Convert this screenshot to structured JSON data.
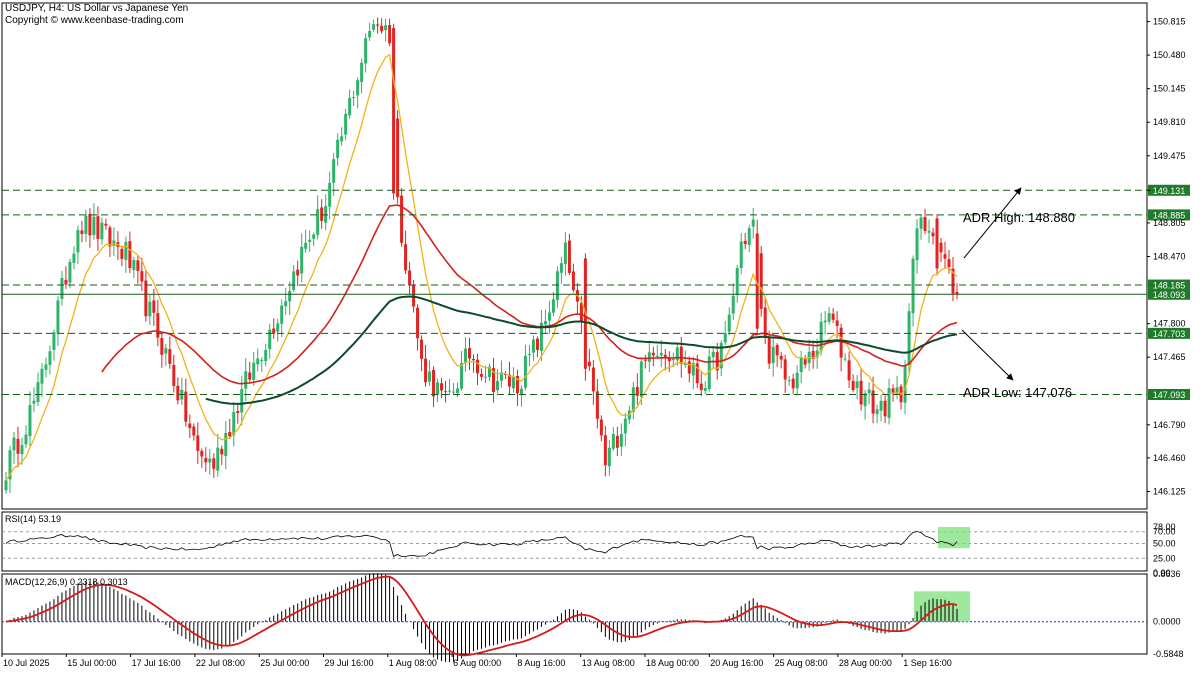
{
  "header": {
    "title": "USDJPY, H4:  US Dollar vs Japanese Yen",
    "copyright": "Copyright © www.keenbase-trading.com"
  },
  "colors": {
    "bull": "#2fb36b",
    "bear": "#e32222",
    "ma_fast": "#f2b21c",
    "ma_mid": "#d42020",
    "ma_slow": "#0c4a2a",
    "level_tag": "#1f7a2a",
    "level_line": "#1a5a1a",
    "highlight": "#7ee07e",
    "macd_signal": "#d61a1a",
    "zero_line": "#3030b0"
  },
  "chart_data": [
    {
      "type": "candlestick",
      "symbol": "USDJPY",
      "timeframe": "H4",
      "ylim": [
        145.95,
        151.0
      ],
      "y_ticks": [
        "150.815",
        "150.480",
        "150.145",
        "149.810",
        "149.475",
        "149.131",
        "148.805",
        "148.470",
        "147.800",
        "147.465",
        "146.790",
        "146.460",
        "146.125"
      ],
      "x_labels": [
        "10 Jul 2025",
        "15 Jul 00:00",
        "17 Jul 16:00",
        "22 Jul 08:00",
        "25 Jul 00:00",
        "29 Jul 16:00",
        "1 Aug 08:00",
        "6 Aug 00:00",
        "8 Aug 16:00",
        "13 Aug 08:00",
        "18 Aug 00:00",
        "20 Aug 16:00",
        "25 Aug 08:00",
        "28 Aug 00:00",
        "1 Sep 16:00"
      ],
      "levels": [
        {
          "value": 149.131,
          "label": "149.131",
          "style": "dashed"
        },
        {
          "value": 148.885,
          "label": "148.885",
          "style": "dashed"
        },
        {
          "value": 148.185,
          "label": "148.185",
          "style": "dashed"
        },
        {
          "value": 148.093,
          "label": "148.093",
          "style": "solid"
        },
        {
          "value": 147.703,
          "label": "147.703",
          "style": "dashed"
        },
        {
          "value": 147.093,
          "label": "147.093",
          "style": "dashed"
        }
      ],
      "annotations": [
        {
          "text": "ADR High: 148.880"
        },
        {
          "text": "ADR Low: 147.076"
        }
      ],
      "anchors": [
        {
          "i": 0,
          "p": 146.35
        },
        {
          "i": 8,
          "p": 147.1
        },
        {
          "i": 18,
          "p": 148.8
        },
        {
          "i": 22,
          "p": 148.75
        },
        {
          "i": 30,
          "p": 148.5
        },
        {
          "i": 40,
          "p": 147.5
        },
        {
          "i": 48,
          "p": 146.5
        },
        {
          "i": 52,
          "p": 146.4
        },
        {
          "i": 60,
          "p": 147.2
        },
        {
          "i": 68,
          "p": 147.9
        },
        {
          "i": 74,
          "p": 148.5
        },
        {
          "i": 80,
          "p": 149.0
        },
        {
          "i": 86,
          "p": 150.0
        },
        {
          "i": 92,
          "p": 150.85
        },
        {
          "i": 96,
          "p": 150.7
        },
        {
          "i": 98,
          "p": 149.0
        },
        {
          "i": 104,
          "p": 147.4
        },
        {
          "i": 110,
          "p": 147.0
        },
        {
          "i": 116,
          "p": 147.5
        },
        {
          "i": 122,
          "p": 147.25
        },
        {
          "i": 128,
          "p": 147.2
        },
        {
          "i": 134,
          "p": 147.7
        },
        {
          "i": 140,
          "p": 148.5
        },
        {
          "i": 146,
          "p": 147.3
        },
        {
          "i": 150,
          "p": 146.4
        },
        {
          "i": 156,
          "p": 147.0
        },
        {
          "i": 162,
          "p": 147.6
        },
        {
          "i": 168,
          "p": 147.5
        },
        {
          "i": 174,
          "p": 147.2
        },
        {
          "i": 180,
          "p": 147.6
        },
        {
          "i": 184,
          "p": 148.6
        },
        {
          "i": 187,
          "p": 148.8
        },
        {
          "i": 190,
          "p": 147.6
        },
        {
          "i": 196,
          "p": 147.2
        },
        {
          "i": 202,
          "p": 147.5
        },
        {
          "i": 206,
          "p": 147.9
        },
        {
          "i": 212,
          "p": 147.2
        },
        {
          "i": 218,
          "p": 146.95
        },
        {
          "i": 224,
          "p": 147.1
        },
        {
          "i": 228,
          "p": 148.75
        },
        {
          "i": 232,
          "p": 148.8
        },
        {
          "i": 234,
          "p": 148.5
        },
        {
          "i": 238,
          "p": 148.093
        }
      ],
      "bar_count": 239
    },
    {
      "type": "line",
      "name": "RSI(14)",
      "title": "RSI(14) 53.19",
      "ylim": [
        0,
        100
      ],
      "y_ticks": [
        "78.00",
        "70.00",
        "50.00",
        "25.00",
        "0.00"
      ],
      "last": 53.19
    },
    {
      "type": "bar",
      "name": "MACD(12,26,9)",
      "title": "MACD(12,26,9) 0.2318 0.3013",
      "y_ticks": [
        "0.8636",
        "0.0000",
        "-0.5848"
      ],
      "ylim": [
        -0.5848,
        0.8636
      ],
      "macd": 0.2318,
      "signal": 0.3013
    }
  ]
}
